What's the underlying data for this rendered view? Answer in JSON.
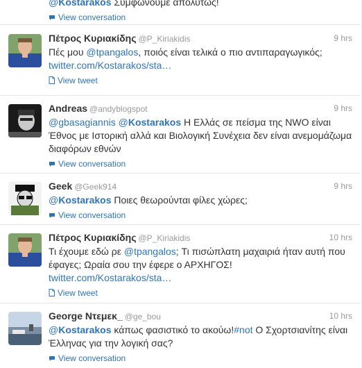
{
  "tweets": [
    {
      "parts": [
        {
          "t": "m",
          "at": "@",
          "v": "Kostarakos"
        },
        {
          "t": "s",
          "v": " Συμφωνούμε απολύτως!"
        }
      ],
      "action": {
        "icon": "conversation-bubble-icon",
        "label": "View conversation"
      }
    },
    {
      "fullname": "Πέτρος Κυριακίδης",
      "username": "@P_Kiriakidis",
      "time": "9 hrs",
      "avatar": "petros",
      "parts": [
        {
          "t": "s",
          "v": "Πές μου "
        },
        {
          "t": "m",
          "at": "@",
          "v": "tpangalos",
          "plain": true
        },
        {
          "t": "s",
          "v": ", ποιός είναι τελικά ο πιο αντιπαραγωγικός;"
        },
        {
          "t": "br"
        },
        {
          "t": "l",
          "v": "twitter.com/Kostarakos/sta…"
        }
      ],
      "action": {
        "icon": "page-icon",
        "label": "View tweet"
      }
    },
    {
      "fullname": "Andreas",
      "username": "@andyblogspot",
      "time": "9 hrs",
      "avatar": "andreas",
      "parts": [
        {
          "t": "m",
          "at": "@",
          "v": "gbasagiannis",
          "plain": true
        },
        {
          "t": "s",
          "v": " "
        },
        {
          "t": "m",
          "at": "@",
          "v": "Kostarakos"
        },
        {
          "t": "s",
          "v": " Η Ελλάς σε πείσμα της NWO είναι Έθνος με Ιστορική αλλά και Βιολογική Συνέχεια δεν είναι ανεμομάζωμα διαφόρων εθνών"
        }
      ],
      "action": {
        "icon": "conversation-bubble-icon",
        "label": "View conversation"
      }
    },
    {
      "fullname": "Geek",
      "username": "@Geek914",
      "time": "9 hrs",
      "avatar": "geek",
      "parts": [
        {
          "t": "m",
          "at": "@",
          "v": "Kostarakos"
        },
        {
          "t": "s",
          "v": " Ποιες θεωρούνται φίλες χώρες;"
        }
      ],
      "action": {
        "icon": "conversation-bubble-icon",
        "label": "View conversation"
      }
    },
    {
      "fullname": "Πέτρος Κυριακίδης",
      "username": "@P_Kiriakidis",
      "time": "10 hrs",
      "avatar": "petros",
      "parts": [
        {
          "t": "s",
          "v": "Τι έχουμε εδώ ρε "
        },
        {
          "t": "m",
          "at": "@",
          "v": "tpangalos",
          "plain": true
        },
        {
          "t": "s",
          "v": "; Τι πισώπλατη μαχαιριά ήταν αυτή που έφαγες; Ωραία σου την έφερε ο ΑΡΧΗΓΟΣ!"
        },
        {
          "t": "br"
        },
        {
          "t": "l",
          "v": "twitter.com/Kostarakos/sta…"
        }
      ],
      "action": {
        "icon": "page-icon",
        "label": "View tweet"
      }
    },
    {
      "fullname": "George Ντεμεκ_",
      "username": "@ge_bou",
      "time": "10 hrs",
      "avatar": "george",
      "parts": [
        {
          "t": "m",
          "at": "@",
          "v": "Kostarakos"
        },
        {
          "t": "s",
          "v": " κάπως φασιστικό το ακούω!"
        },
        {
          "t": "m",
          "at": "#",
          "v": "not",
          "plain": true
        },
        {
          "t": "s",
          "v": " Ο Σχορτσιανίτης είναι Έλληνας για την λογική σας?"
        }
      ],
      "action": {
        "icon": "conversation-bubble-icon",
        "label": "View conversation"
      }
    }
  ]
}
